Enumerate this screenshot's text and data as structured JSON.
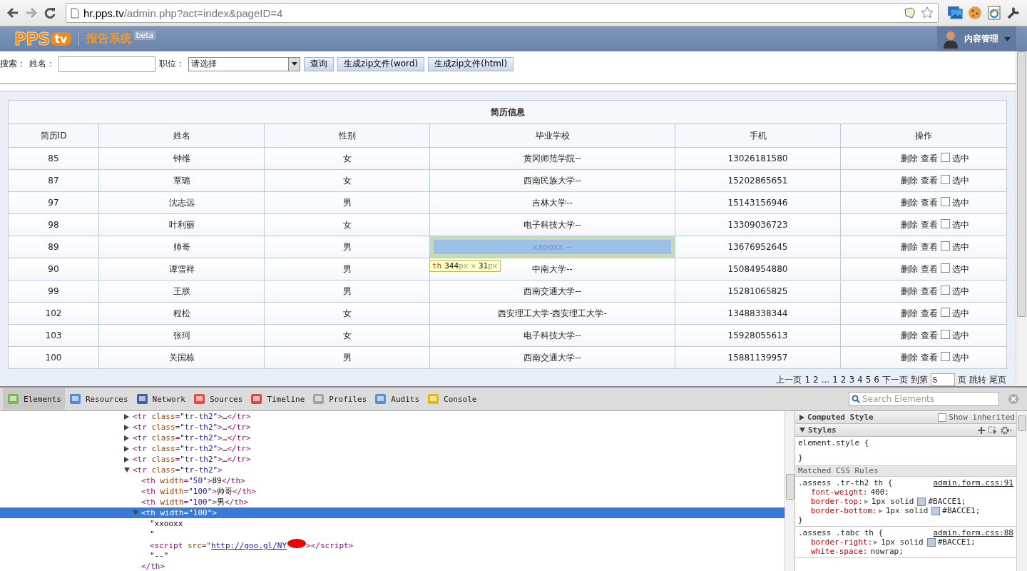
{
  "browser": {
    "url_host": "hr.pps.tv",
    "url_path": "/admin.php?act=index&pageID=4"
  },
  "header": {
    "logo_main": "PPS",
    "logo_suffix": "tv",
    "system_name": "报告系统",
    "badge": "beta",
    "user_menu": "内容管理"
  },
  "search": {
    "label": "搜索：",
    "name_label": "姓名：",
    "position_label": "职位：",
    "position_select": "请选择",
    "buttons": [
      "查询",
      "生成zip文件(word)",
      "生成zip文件(html)"
    ]
  },
  "table": {
    "title": "简历信息",
    "columns": [
      "简历ID",
      "姓名",
      "性别",
      "毕业学校",
      "手机",
      "操作"
    ],
    "rows": [
      {
        "id": "85",
        "name": "钟维",
        "gender": "女",
        "school": "黄冈师范学院--",
        "phone": "13026181580",
        "actions": [
          "删除",
          "查看"
        ],
        "checked": false,
        "check_label": "选中",
        "highlighted": false
      },
      {
        "id": "87",
        "name": "覃璐",
        "gender": "女",
        "school": "西南民族大学--",
        "phone": "15202865651",
        "actions": [
          "删除",
          "查看"
        ],
        "checked": false,
        "check_label": "选中",
        "highlighted": false
      },
      {
        "id": "97",
        "name": "沈志远",
        "gender": "男",
        "school": "吉林大学--",
        "phone": "15143156946",
        "actions": [
          "删除",
          "查看"
        ],
        "checked": false,
        "check_label": "选中",
        "highlighted": false
      },
      {
        "id": "98",
        "name": "叶利丽",
        "gender": "女",
        "school": "电子科技大学--",
        "phone": "13309036723",
        "actions": [
          "删除",
          "查看"
        ],
        "checked": false,
        "check_label": "选中",
        "highlighted": false
      },
      {
        "id": "89",
        "name": "帅哥",
        "gender": "男",
        "school": "xxooxx --",
        "phone": "13676952645",
        "actions": [
          "删除",
          "查看"
        ],
        "checked": false,
        "check_label": "选中",
        "highlighted": true
      },
      {
        "id": "90",
        "name": "谭雪祥",
        "gender": "男",
        "school": "中南大学--",
        "phone": "15084954880",
        "actions": [
          "删除",
          "查看"
        ],
        "checked": false,
        "check_label": "选中",
        "highlighted": false
      },
      {
        "id": "99",
        "name": "王朕",
        "gender": "男",
        "school": "西南交通大学--",
        "phone": "15281065825",
        "actions": [
          "删除",
          "查看"
        ],
        "checked": false,
        "check_label": "选中",
        "highlighted": false
      },
      {
        "id": "102",
        "name": "程松",
        "gender": "女",
        "school": "西安理工大学-西安理工大学-",
        "phone": "13488338344",
        "actions": [
          "删除",
          "查看"
        ],
        "checked": false,
        "check_label": "选中",
        "highlighted": false
      },
      {
        "id": "103",
        "name": "张珂",
        "gender": "女",
        "school": "电子科技大学--",
        "phone": "15928055613",
        "actions": [
          "删除",
          "查看"
        ],
        "checked": false,
        "check_label": "选中",
        "highlighted": false
      },
      {
        "id": "100",
        "name": "关国栋",
        "gender": "男",
        "school": "西南交通大学--",
        "phone": "15881139957",
        "actions": [
          "删除",
          "查看"
        ],
        "checked": false,
        "check_label": "选中",
        "highlighted": false
      }
    ]
  },
  "size_tooltip": [
    {
      "kind": "tag",
      "text": "th"
    },
    {
      "kind": "number",
      "text": "344"
    },
    {
      "kind": "unit",
      "text": "px"
    },
    {
      "kind": "unit",
      "text": "×"
    },
    {
      "kind": "number",
      "text": "31"
    },
    {
      "kind": "unit",
      "text": "px"
    }
  ],
  "pagination": [
    {
      "kind": "link",
      "text": "上一页"
    },
    {
      "kind": "link",
      "text": "1"
    },
    {
      "kind": "link",
      "text": "2"
    },
    {
      "kind": "text",
      "text": "..."
    },
    {
      "kind": "link",
      "text": "1"
    },
    {
      "kind": "link",
      "text": "2"
    },
    {
      "kind": "link",
      "text": "3"
    },
    {
      "kind": "link",
      "text": "4"
    },
    {
      "kind": "link",
      "text": "5"
    },
    {
      "kind": "link",
      "text": "6"
    },
    {
      "kind": "link",
      "text": "下一页"
    },
    {
      "kind": "text",
      "text": "到第"
    },
    {
      "kind": "input",
      "text": "5"
    },
    {
      "kind": "text",
      "text": "页"
    },
    {
      "kind": "link",
      "text": "跳转"
    },
    {
      "kind": "link",
      "text": "尾页"
    }
  ],
  "devtools": {
    "tabs": [
      {
        "label": "Elements",
        "selected": true
      },
      {
        "label": "Resources",
        "selected": false
      },
      {
        "label": "Network",
        "selected": false
      },
      {
        "label": "Sources",
        "selected": false
      },
      {
        "label": "Timeline",
        "selected": false
      },
      {
        "label": "Profiles",
        "selected": false
      },
      {
        "label": "Audits",
        "selected": false
      },
      {
        "label": "Console",
        "selected": false
      }
    ],
    "search_placeholder": "Search Elements",
    "dom": [
      {
        "kind": "element",
        "expanded": false,
        "selected": false,
        "tokens": [
          {
            "kind": "tag",
            "text": "<tr "
          },
          {
            "kind": "attr",
            "text": "class"
          },
          {
            "kind": "tag",
            "text": "="
          },
          {
            "kind": "value",
            "text": "\"tr-th2\""
          },
          {
            "kind": "tag",
            "text": ">"
          },
          {
            "kind": "text",
            "text": "…"
          },
          {
            "kind": "tag",
            "text": "</tr>"
          }
        ]
      },
      {
        "kind": "element",
        "expanded": false,
        "selected": false,
        "tokens": [
          {
            "kind": "tag",
            "text": "<tr "
          },
          {
            "kind": "attr",
            "text": "class"
          },
          {
            "kind": "tag",
            "text": "="
          },
          {
            "kind": "value",
            "text": "\"tr-th2\""
          },
          {
            "kind": "tag",
            "text": ">"
          },
          {
            "kind": "text",
            "text": "…"
          },
          {
            "kind": "tag",
            "text": "</tr>"
          }
        ]
      },
      {
        "kind": "element",
        "expanded": false,
        "selected": false,
        "tokens": [
          {
            "kind": "tag",
            "text": "<tr "
          },
          {
            "kind": "attr",
            "text": "class"
          },
          {
            "kind": "tag",
            "text": "="
          },
          {
            "kind": "value",
            "text": "\"tr-th2\""
          },
          {
            "kind": "tag",
            "text": ">"
          },
          {
            "kind": "text",
            "text": "…"
          },
          {
            "kind": "tag",
            "text": "</tr>"
          }
        ]
      },
      {
        "kind": "element",
        "expanded": false,
        "selected": false,
        "tokens": [
          {
            "kind": "tag",
            "text": "<tr "
          },
          {
            "kind": "attr",
            "text": "class"
          },
          {
            "kind": "tag",
            "text": "="
          },
          {
            "kind": "value",
            "text": "\"tr-th2\""
          },
          {
            "kind": "tag",
            "text": ">"
          },
          {
            "kind": "text",
            "text": "…"
          },
          {
            "kind": "tag",
            "text": "</tr>"
          }
        ]
      },
      {
        "kind": "element",
        "expanded": false,
        "selected": false,
        "tokens": [
          {
            "kind": "tag",
            "text": "<tr "
          },
          {
            "kind": "attr",
            "text": "class"
          },
          {
            "kind": "tag",
            "text": "="
          },
          {
            "kind": "value",
            "text": "\"tr-th2\""
          },
          {
            "kind": "tag",
            "text": ">"
          },
          {
            "kind": "text",
            "text": "…"
          },
          {
            "kind": "tag",
            "text": "</tr>"
          }
        ]
      },
      {
        "kind": "element",
        "expanded": true,
        "selected": false,
        "tokens": [
          {
            "kind": "tag",
            "text": "<tr "
          },
          {
            "kind": "attr",
            "text": "class"
          },
          {
            "kind": "tag",
            "text": "="
          },
          {
            "kind": "value",
            "text": "\"tr-th2\""
          },
          {
            "kind": "tag",
            "text": ">"
          }
        ],
        "children": [
          {
            "kind": "leaf",
            "selected": false,
            "tokens": [
              {
                "kind": "tag",
                "text": "<th "
              },
              {
                "kind": "attr",
                "text": "width"
              },
              {
                "kind": "tag",
                "text": "="
              },
              {
                "kind": "value",
                "text": "\"50\""
              },
              {
                "kind": "tag",
                "text": ">"
              },
              {
                "kind": "text",
                "text": "89"
              },
              {
                "kind": "tag",
                "text": "</th>"
              }
            ]
          },
          {
            "kind": "leaf",
            "selected": false,
            "tokens": [
              {
                "kind": "tag",
                "text": "<th "
              },
              {
                "kind": "attr",
                "text": "width"
              },
              {
                "kind": "tag",
                "text": "="
              },
              {
                "kind": "value",
                "text": "\"100\""
              },
              {
                "kind": "tag",
                "text": ">"
              },
              {
                "kind": "text",
                "text": "帅哥"
              },
              {
                "kind": "tag",
                "text": "</th>"
              }
            ]
          },
          {
            "kind": "leaf",
            "selected": false,
            "tokens": [
              {
                "kind": "tag",
                "text": "<th "
              },
              {
                "kind": "attr",
                "text": "width"
              },
              {
                "kind": "tag",
                "text": "="
              },
              {
                "kind": "value",
                "text": "\"100\""
              },
              {
                "kind": "tag",
                "text": ">"
              },
              {
                "kind": "text",
                "text": "男"
              },
              {
                "kind": "tag",
                "text": "</th>"
              }
            ]
          },
          {
            "kind": "element",
            "expanded": true,
            "selected": true,
            "tokens": [
              {
                "kind": "tag",
                "text": "<th "
              },
              {
                "kind": "attr",
                "text": "width"
              },
              {
                "kind": "tag",
                "text": "="
              },
              {
                "kind": "value",
                "text": "\"100\""
              },
              {
                "kind": "tag",
                "text": ">"
              }
            ],
            "children": [
              {
                "kind": "leaf",
                "selected": false,
                "tokens": [
                  {
                    "kind": "text",
                    "text": "\"xxooxx"
                  }
                ]
              },
              {
                "kind": "leaf",
                "selected": false,
                "tokens": [
                  {
                    "kind": "text",
                    "text": "\""
                  }
                ]
              },
              {
                "kind": "leaf",
                "selected": false,
                "tokens": [
                  {
                    "kind": "tag",
                    "text": "<script "
                  },
                  {
                    "kind": "attr",
                    "text": "src"
                  },
                  {
                    "kind": "tag",
                    "text": "=\""
                  },
                  {
                    "kind": "link",
                    "text": "http://goo.gl/NY"
                  },
                  {
                    "kind": "redacted"
                  },
                  {
                    "kind": "tag",
                    "text": "></script>"
                  }
                ]
              },
              {
                "kind": "leaf",
                "selected": false,
                "tokens": [
                  {
                    "kind": "text",
                    "text": "\"--\""
                  }
                ]
              }
            ]
          },
          {
            "kind": "leaf",
            "selected": false,
            "tokens": [
              {
                "kind": "tag",
                "text": "</th>"
              }
            ]
          }
        ]
      }
    ],
    "computed_title": "Computed Style",
    "show_inherited": {
      "label": "Show inherited",
      "checked": false
    },
    "styles_title": "Styles",
    "matched_title": "Matched CSS Rules",
    "rules": [
      {
        "kind": "inline",
        "selector": "element.style {",
        "close": "}"
      },
      {
        "kind": "matched",
        "selector": ".assess .tr-th2 th {",
        "source": "admin.form.css:91",
        "close": "}",
        "properties": [
          {
            "name": "font-weight:",
            "expandable": false,
            "value": "400;"
          },
          {
            "name": "border-top:",
            "expandable": true,
            "value": "1px solid",
            "color": "#bacce1",
            "color_text": "#BACCE1;"
          },
          {
            "name": "border-bottom:",
            "expandable": true,
            "value": "1px solid",
            "color": "#bacce1",
            "color_text": "#BACCE1;"
          }
        ]
      },
      {
        "kind": "matched",
        "selector": ".assess .tabc th {",
        "source": "admin.form.css:88",
        "properties": [
          {
            "name": "border-right:",
            "expandable": true,
            "value": "1px solid",
            "color": "#bacce1",
            "color_text": "#BACCE1;"
          },
          {
            "name": "white-space:",
            "expandable": false,
            "value": "nowrap;"
          }
        ]
      }
    ]
  }
}
